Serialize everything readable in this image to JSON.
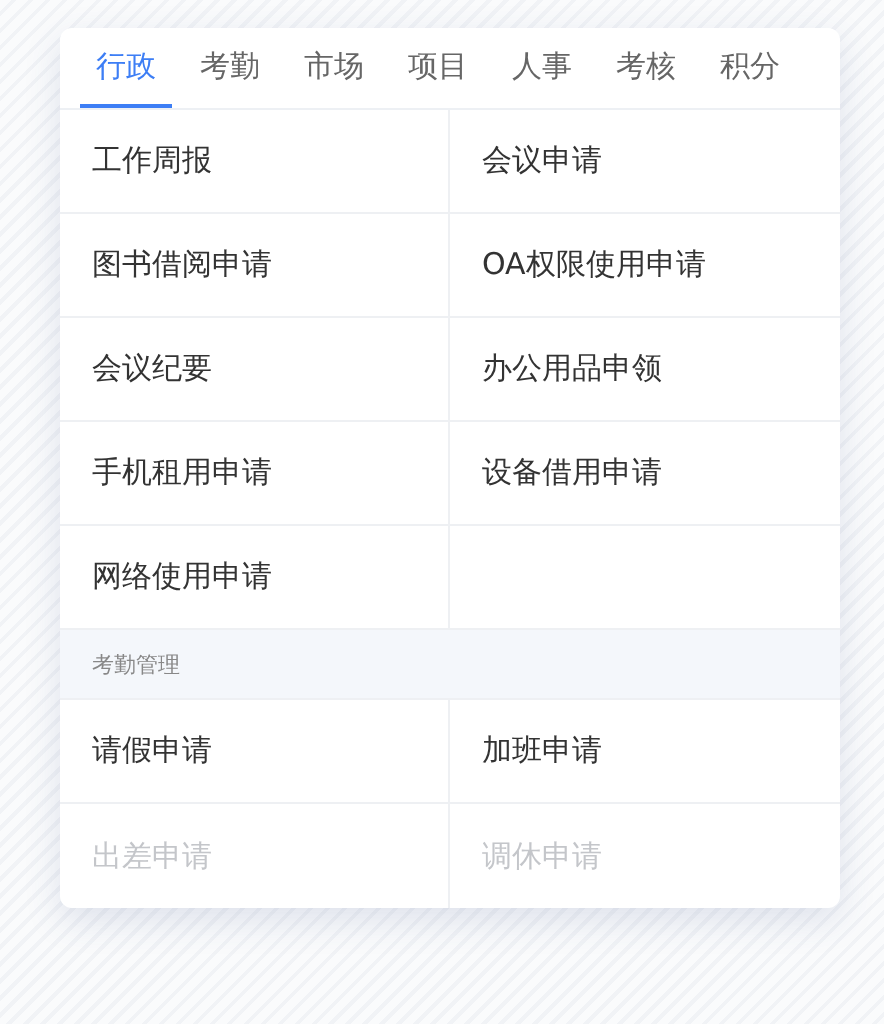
{
  "tabs": [
    {
      "label": "行政",
      "selected": true
    },
    {
      "label": "考勤",
      "selected": false
    },
    {
      "label": "市场",
      "selected": false
    },
    {
      "label": "项目",
      "selected": false
    },
    {
      "label": "人事",
      "selected": false
    },
    {
      "label": "考核",
      "selected": false
    },
    {
      "label": "积分",
      "selected": false
    }
  ],
  "sections": [
    {
      "items": [
        {
          "label": "工作周报",
          "faded": false
        },
        {
          "label": "会议申请",
          "faded": false
        },
        {
          "label": "图书借阅申请",
          "faded": false
        },
        {
          "label": "OA权限使用申请",
          "faded": false
        },
        {
          "label": "会议纪要",
          "faded": false
        },
        {
          "label": "办公用品申领",
          "faded": false
        },
        {
          "label": "手机租用申请",
          "faded": false
        },
        {
          "label": "设备借用申请",
          "faded": false
        },
        {
          "label": "网络使用申请",
          "faded": false
        }
      ]
    },
    {
      "title": "考勤管理",
      "items": [
        {
          "label": "请假申请",
          "faded": false
        },
        {
          "label": "加班申请",
          "faded": false
        },
        {
          "label": "出差申请",
          "faded": true
        },
        {
          "label": "调休申请",
          "faded": true
        }
      ]
    }
  ]
}
